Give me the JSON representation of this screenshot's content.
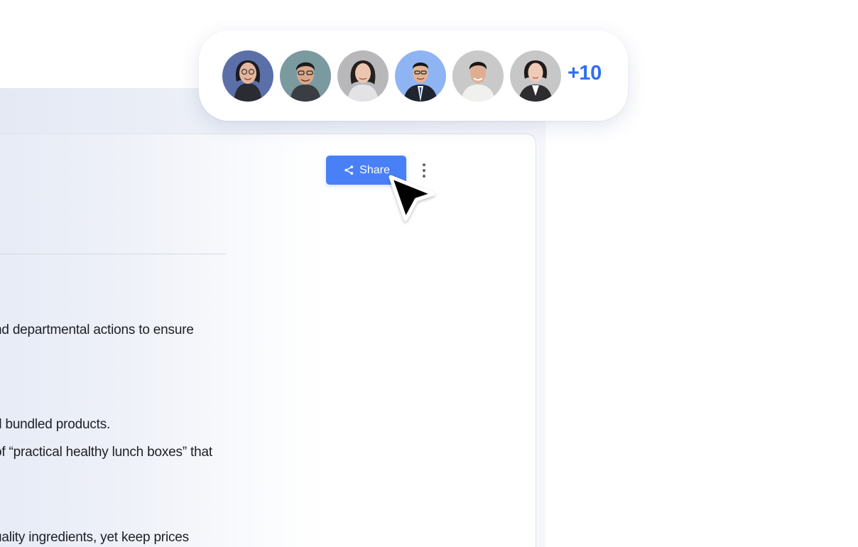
{
  "share_button": {
    "label": "Share",
    "icon": "share-icon"
  },
  "more_menu": {
    "icon": "more-vertical-icon"
  },
  "collaborators": {
    "avatars": [
      {
        "name": "avatar-1",
        "bg": "#5b6fa8"
      },
      {
        "name": "avatar-2",
        "bg": "#7a9aa0"
      },
      {
        "name": "avatar-3",
        "bg": "#b8b8bb"
      },
      {
        "name": "avatar-4",
        "bg": "#8fb4f3"
      },
      {
        "name": "avatar-5",
        "bg": "#c9c9ca"
      },
      {
        "name": "avatar-6",
        "bg": "#c7c7c8"
      }
    ],
    "more_count": "+10"
  },
  "document": {
    "lines": [
      "nd departmental actions to ensure",
      "d bundled products.",
      "of “practical healthy lunch boxes” that",
      "uality ingredients, yet keep prices"
    ]
  },
  "colors": {
    "accent": "#4a80f7",
    "count_text": "#2f6ff0"
  }
}
